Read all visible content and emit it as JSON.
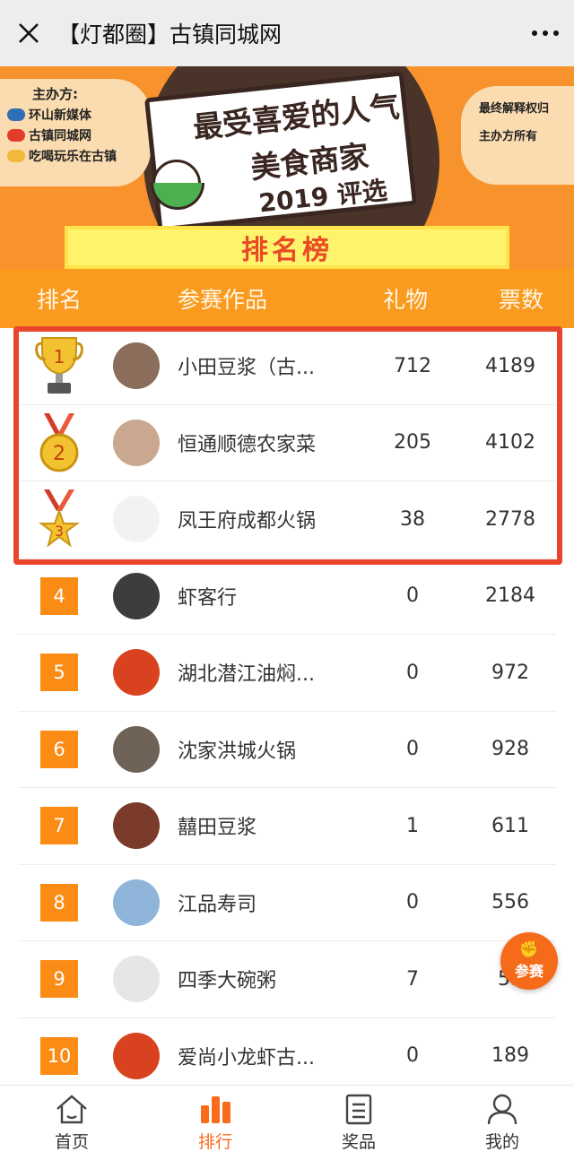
{
  "topbar": {
    "title": "【灯都圈】古镇同城网"
  },
  "banner": {
    "organizer_title": "主办方:",
    "organizers": [
      "环山新媒体",
      "古镇同城网",
      "吃喝玩乐在古镇"
    ],
    "title_line1": "最受喜爱的人气",
    "title_line2": "美食商家",
    "title_line3": "2019 评选",
    "rights_line1": "最终解释权归",
    "rights_line2": "主办方所有",
    "ranking_label": "排名榜"
  },
  "table": {
    "headers": {
      "rank": "排名",
      "work": "参赛作品",
      "gift": "礼物",
      "votes": "票数"
    },
    "rows": [
      {
        "rank": "1",
        "name": "小田豆浆（古...",
        "gift": "712",
        "votes": "4189",
        "medal": "gold-trophy",
        "avatar_color": "#8a6d5a"
      },
      {
        "rank": "2",
        "name": "恒通顺德农家菜",
        "gift": "205",
        "votes": "4102",
        "medal": "gold-medal",
        "avatar_color": "#c9a88f"
      },
      {
        "rank": "3",
        "name": "凤王府成都火锅",
        "gift": "38",
        "votes": "2778",
        "medal": "star-medal",
        "avatar_color": "#f2f2f2"
      },
      {
        "rank": "4",
        "name": "虾客行",
        "gift": "0",
        "votes": "2184",
        "avatar_color": "#3d3d3d"
      },
      {
        "rank": "5",
        "name": "湖北潜江油焖...",
        "gift": "0",
        "votes": "972",
        "avatar_color": "#d8421f"
      },
      {
        "rank": "6",
        "name": "沈家洪城火锅",
        "gift": "0",
        "votes": "928",
        "avatar_color": "#6f6257"
      },
      {
        "rank": "7",
        "name": "囍田豆浆",
        "gift": "1",
        "votes": "611",
        "avatar_color": "#7a3b2a"
      },
      {
        "rank": "8",
        "name": "江品寿司",
        "gift": "0",
        "votes": "556",
        "avatar_color": "#8fb4d9"
      },
      {
        "rank": "9",
        "name": "四季大碗粥",
        "gift": "7",
        "votes": "51",
        "avatar_color": "#e6e6e6"
      },
      {
        "rank": "10",
        "name": "爱尚小龙虾古...",
        "gift": "0",
        "votes": "189",
        "avatar_color": "#d8421f"
      }
    ]
  },
  "float_button": {
    "label": "参赛"
  },
  "tabbar": {
    "tabs": [
      {
        "label": "首页",
        "icon": "home-icon"
      },
      {
        "label": "排行",
        "icon": "ranking-bars-icon",
        "active": true
      },
      {
        "label": "奖品",
        "icon": "prize-list-icon"
      },
      {
        "label": "我的",
        "icon": "user-icon"
      }
    ]
  },
  "colors": {
    "accent": "#fa9a1e",
    "highlight_frame": "#e8452c",
    "active_tab": "#fa6b1a"
  }
}
